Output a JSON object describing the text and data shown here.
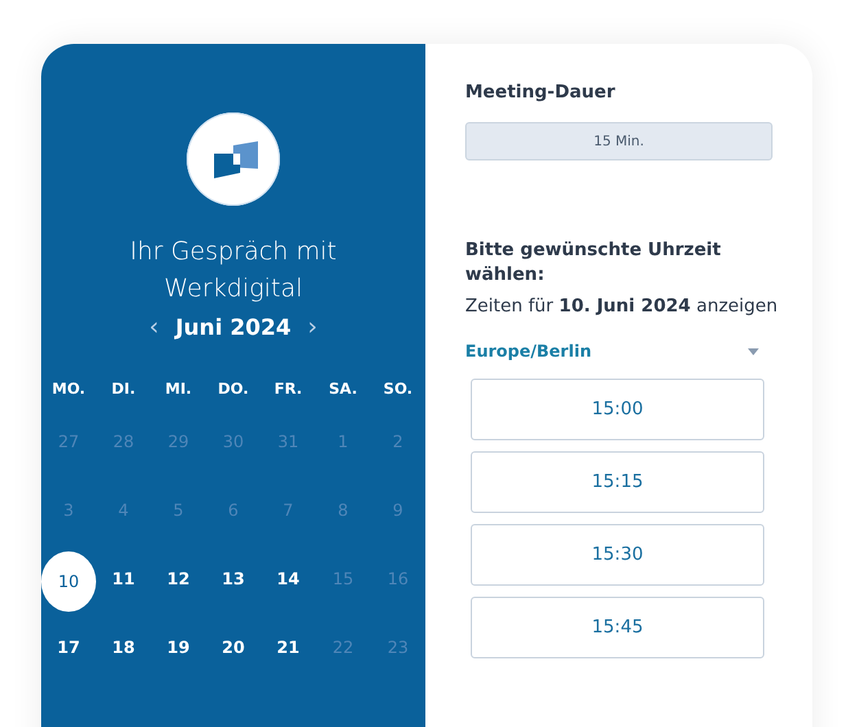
{
  "calendar": {
    "title": "Ihr Gespräch mit Werkdigital",
    "month": "Juni 2024",
    "prev": "‹",
    "next": "›",
    "weekdays": [
      "MO.",
      "DI.",
      "MI.",
      "DO.",
      "FR.",
      "SA.",
      "SO."
    ],
    "weeks": [
      [
        {
          "day": "27",
          "available": false,
          "selected": false
        },
        {
          "day": "28",
          "available": false,
          "selected": false
        },
        {
          "day": "29",
          "available": false,
          "selected": false
        },
        {
          "day": "30",
          "available": false,
          "selected": false
        },
        {
          "day": "31",
          "available": false,
          "selected": false
        },
        {
          "day": "1",
          "available": false,
          "selected": false
        },
        {
          "day": "2",
          "available": false,
          "selected": false
        }
      ],
      [
        {
          "day": "3",
          "available": false,
          "selected": false
        },
        {
          "day": "4",
          "available": false,
          "selected": false
        },
        {
          "day": "5",
          "available": false,
          "selected": false
        },
        {
          "day": "6",
          "available": false,
          "selected": false
        },
        {
          "day": "7",
          "available": false,
          "selected": false
        },
        {
          "day": "8",
          "available": false,
          "selected": false
        },
        {
          "day": "9",
          "available": false,
          "selected": false
        }
      ],
      [
        {
          "day": "10",
          "available": true,
          "selected": true
        },
        {
          "day": "11",
          "available": true,
          "selected": false
        },
        {
          "day": "12",
          "available": true,
          "selected": false
        },
        {
          "day": "13",
          "available": true,
          "selected": false
        },
        {
          "day": "14",
          "available": true,
          "selected": false
        },
        {
          "day": "15",
          "available": false,
          "selected": false
        },
        {
          "day": "16",
          "available": false,
          "selected": false
        }
      ],
      [
        {
          "day": "17",
          "available": true,
          "selected": false
        },
        {
          "day": "18",
          "available": true,
          "selected": false
        },
        {
          "day": "19",
          "available": true,
          "selected": false
        },
        {
          "day": "20",
          "available": true,
          "selected": false
        },
        {
          "day": "21",
          "available": true,
          "selected": false
        },
        {
          "day": "22",
          "available": false,
          "selected": false
        },
        {
          "day": "23",
          "available": false,
          "selected": false
        }
      ]
    ]
  },
  "duration": {
    "label": "Meeting-Dauer",
    "value": "15 Min."
  },
  "times": {
    "heading": "Bitte gewünschte Uhrzeit wählen:",
    "subtitle": "Zeiten für **10. Juni 2024** anzeigen",
    "timezone": "Europe/Berlin",
    "slots": [
      "15:00",
      "15:15",
      "15:30",
      "15:45"
    ]
  }
}
